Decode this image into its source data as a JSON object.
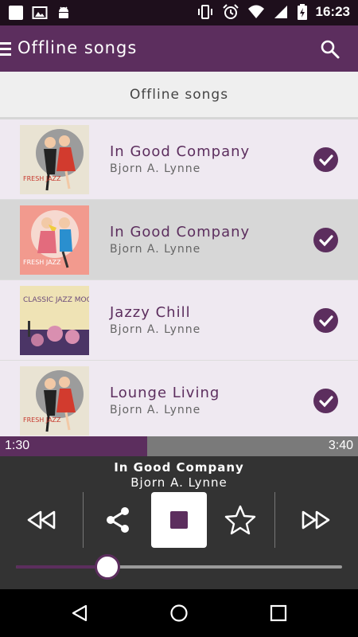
{
  "status_bar": {
    "time": "16:23"
  },
  "app_bar": {
    "title": "Offline songs"
  },
  "section": {
    "title": "Offline songs"
  },
  "songs": [
    {
      "title": "In Good Company",
      "artist": "Bjorn A. Lynne",
      "cover_text": "FRESH JAZZ",
      "downloaded": true,
      "selected": false
    },
    {
      "title": "In Good Company",
      "artist": "Bjorn A. Lynne",
      "cover_text": "FRESH JAZZ",
      "downloaded": true,
      "selected": true
    },
    {
      "title": "Jazzy Chill",
      "artist": "Bjorn A. Lynne",
      "cover_text": "CLASSIC JAZZ MOODS",
      "downloaded": true,
      "selected": false
    },
    {
      "title": "Lounge Living",
      "artist": "Bjorn A. Lynne",
      "cover_text": "FRESH JAZZ",
      "downloaded": true,
      "selected": false
    }
  ],
  "player": {
    "elapsed": "1:30",
    "total": "3:40",
    "progress": 0.41,
    "now_playing_title": "In Good Company",
    "now_playing_artist": "Bjorn A. Lynne",
    "volume": 0.28
  },
  "colors": {
    "primary": "#5c2e5e",
    "status_bar": "#1e0f1c",
    "list_background": "#efe9f1",
    "player_background": "#333333"
  }
}
